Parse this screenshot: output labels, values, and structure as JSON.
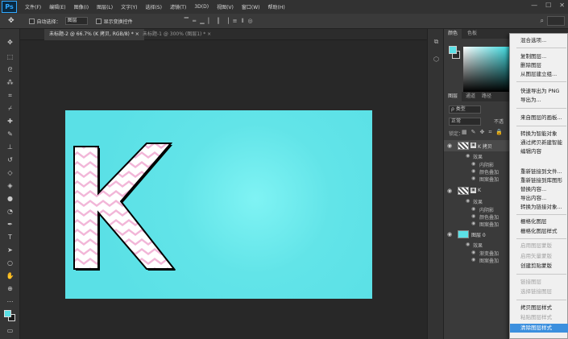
{
  "app": {
    "logo": "Ps"
  },
  "menubar": {
    "items": [
      "文件(F)",
      "编辑(E)",
      "图像(I)",
      "图层(L)",
      "文字(Y)",
      "选择(S)",
      "滤镜(T)",
      "3D(D)",
      "视图(V)",
      "窗口(W)",
      "帮助(H)"
    ]
  },
  "options": {
    "auto_select_label": "自动选择：",
    "auto_select_value": "图层",
    "transform_label": "显示变换控件"
  },
  "tabs": [
    {
      "label": "未标题-2 @ 66.7% (K 拷贝, RGB/8) *  ×"
    },
    {
      "label": "未标题-1 @ 300% (图层1) *  ×"
    }
  ],
  "canvas": {
    "letter": "K",
    "background_color": "#5ce0e6",
    "letter_fill": "#f2b6d8"
  },
  "color_panel": {
    "tabs": [
      "颜色",
      "色板"
    ]
  },
  "layers_panel": {
    "tabs": [
      "图层",
      "通道",
      "路径"
    ],
    "filter": "ρ 类型",
    "blend": "正常",
    "lock_label": "锁定：",
    "opacity_label": "不透",
    "layers": [
      {
        "name": "K 拷贝",
        "effects_title": "效果",
        "effects": [
          "内阴影",
          "颜色叠加",
          "图案叠加"
        ]
      },
      {
        "name": "K",
        "effects_title": "效果",
        "effects": [
          "内阴影",
          "颜色叠加",
          "图案叠加"
        ]
      },
      {
        "name": "图层 0",
        "effects_title": "效果",
        "effects": [
          "渐变叠加",
          "图案叠加"
        ]
      }
    ]
  },
  "context_menu": {
    "items": [
      {
        "label": "混合选项...",
        "state": "normal"
      },
      {
        "label": "复制图层...",
        "state": "normal"
      },
      {
        "label": "删除图层",
        "state": "normal"
      },
      {
        "label": "从图层建立组...",
        "state": "normal"
      },
      {
        "label": "快速导出为 PNG",
        "state": "normal"
      },
      {
        "label": "导出为...",
        "state": "normal"
      },
      {
        "label": "来自图层的画板...",
        "state": "normal"
      },
      {
        "label": "转换为智能对象",
        "state": "normal"
      },
      {
        "label": "通过拷贝新建智能",
        "state": "normal"
      },
      {
        "label": "编辑内容",
        "state": "normal"
      },
      {
        "label": "重新链接到文件...",
        "state": "normal"
      },
      {
        "label": "重新链接到库图形",
        "state": "normal"
      },
      {
        "label": "替换内容...",
        "state": "normal"
      },
      {
        "label": "导出内容...",
        "state": "normal"
      },
      {
        "label": "转换为链接对象...",
        "state": "normal"
      },
      {
        "label": "栅格化图层",
        "state": "normal"
      },
      {
        "label": "栅格化图层样式",
        "state": "normal"
      },
      {
        "label": "启用图层蒙版",
        "state": "disabled"
      },
      {
        "label": "启用矢量蒙版",
        "state": "disabled"
      },
      {
        "label": "创建剪贴蒙版",
        "state": "normal"
      },
      {
        "label": "链接图层",
        "state": "disabled"
      },
      {
        "label": "选择链接图层",
        "state": "disabled"
      },
      {
        "label": "拷贝图层样式",
        "state": "normal"
      },
      {
        "label": "粘贴图层样式",
        "state": "disabled"
      },
      {
        "label": "清除图层样式",
        "state": "highlight"
      }
    ]
  }
}
